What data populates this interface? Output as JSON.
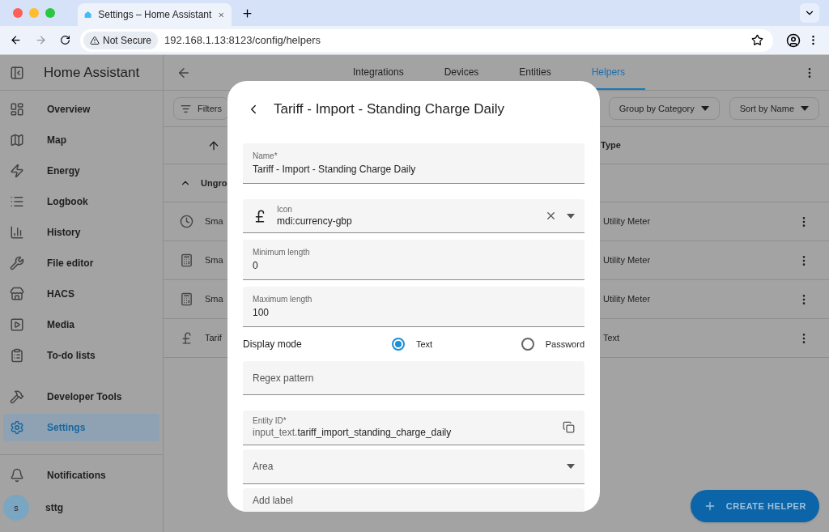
{
  "browser": {
    "tab_title": "Settings – Home Assistant",
    "security": "Not Secure",
    "url": "192.168.1.13:8123/config/helpers"
  },
  "sidebar": {
    "title": "Home Assistant",
    "items": [
      {
        "label": "Overview",
        "selected": false
      },
      {
        "label": "Map",
        "selected": false
      },
      {
        "label": "Energy",
        "selected": false
      },
      {
        "label": "Logbook",
        "selected": false
      },
      {
        "label": "History",
        "selected": false
      },
      {
        "label": "File editor",
        "selected": false
      },
      {
        "label": "HACS",
        "selected": false
      },
      {
        "label": "Media",
        "selected": false
      },
      {
        "label": "To-do lists",
        "selected": false
      },
      {
        "label": "Developer Tools",
        "selected": false
      },
      {
        "label": "Settings",
        "selected": true
      }
    ],
    "notifications": "Notifications",
    "user": {
      "initial": "s",
      "name": "sttg"
    }
  },
  "tabs": [
    {
      "label": "Integrations",
      "selected": false
    },
    {
      "label": "Devices",
      "selected": false
    },
    {
      "label": "Entities",
      "selected": false
    },
    {
      "label": "Helpers",
      "selected": true
    }
  ],
  "toolbar": {
    "filters": "Filters",
    "group_by": "Group by Category",
    "sort_by": "Sort by Name"
  },
  "table": {
    "type_column": "Type",
    "group": "Ungro",
    "rows": [
      {
        "name": "Sma",
        "type": "Utility Meter"
      },
      {
        "name": "Sma",
        "type": "Utility Meter"
      },
      {
        "name": "Sma",
        "type": "Utility Meter"
      },
      {
        "name": "Tarif",
        "type": "Text"
      }
    ]
  },
  "dialog": {
    "title": "Tariff - Import - Standing Charge Daily",
    "name": {
      "label": "Name*",
      "value": "Tariff - Import - Standing Charge Daily"
    },
    "icon": {
      "label": "Icon",
      "value": "mdi:currency-gbp"
    },
    "min_length": {
      "label": "Minimum length",
      "value": "0"
    },
    "max_length": {
      "label": "Maximum length",
      "value": "100"
    },
    "display_mode": {
      "label": "Display mode",
      "options": [
        {
          "label": "Text",
          "selected": true
        },
        {
          "label": "Password",
          "selected": false
        }
      ]
    },
    "regex": {
      "placeholder": "Regex pattern"
    },
    "entity_id": {
      "label": "Entity ID*",
      "prefix": "input_text.",
      "value": "tariff_import_standing_charge_daily"
    },
    "area": {
      "placeholder": "Area"
    },
    "label": {
      "placeholder": "Add label"
    }
  },
  "fab": "CREATE HELPER"
}
